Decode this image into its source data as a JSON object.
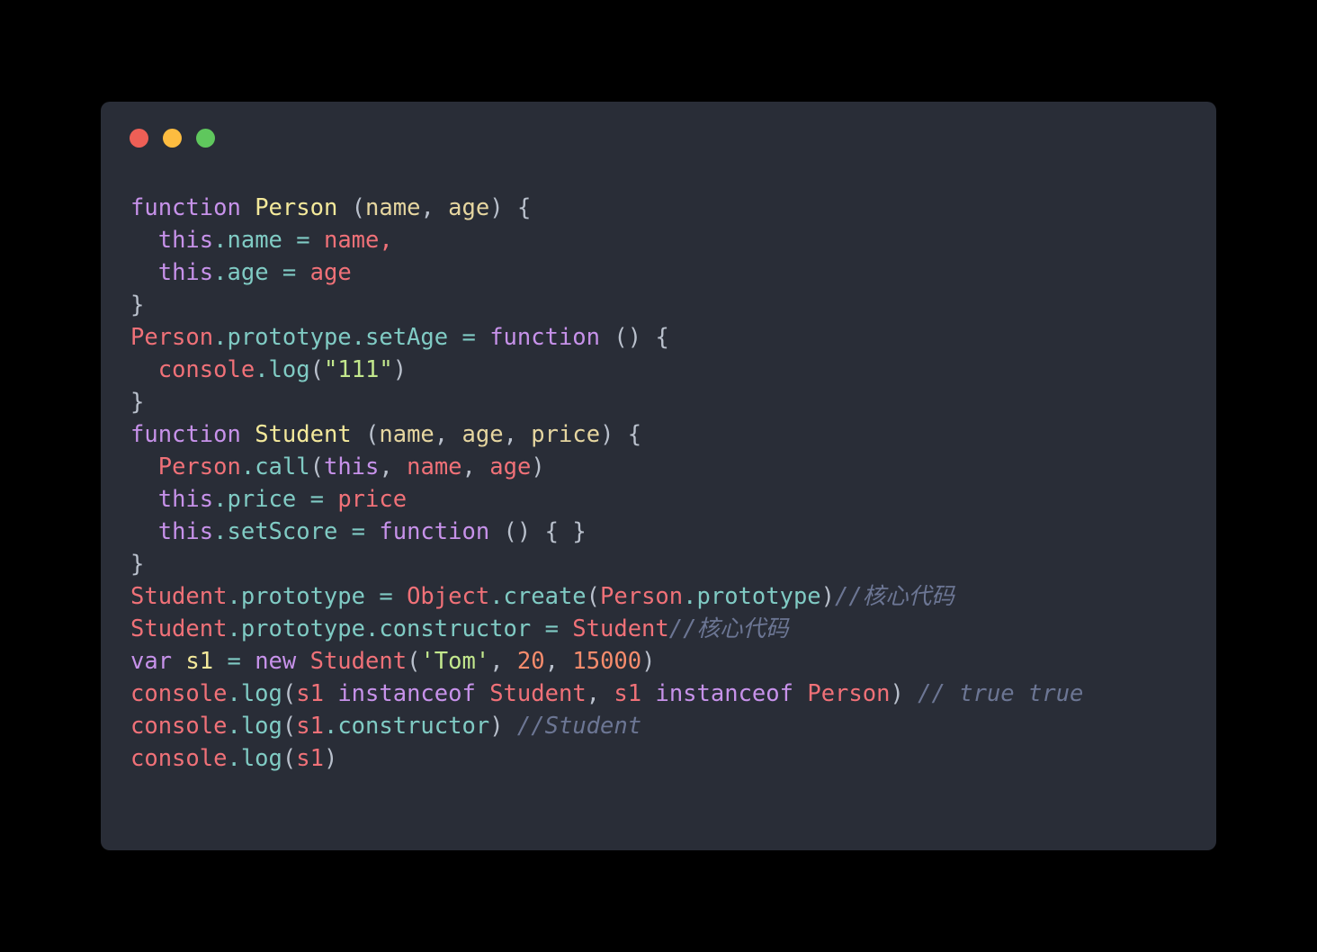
{
  "window": {
    "name": "code-snippet-card",
    "background_color": "#000000",
    "card_color": "#292d37",
    "controls": [
      {
        "name": "close",
        "label": "Close",
        "color": "#ee5f56"
      },
      {
        "name": "minimize",
        "label": "Minimize",
        "color": "#fdbc40"
      },
      {
        "name": "maximize",
        "label": "Maximize",
        "color": "#5fc75d"
      }
    ]
  },
  "theme": {
    "keyword": "#c792ea",
    "function_name": "#f4e99b",
    "parameter": "#e6d6a0",
    "identifier": "#f07178",
    "property": "#80cbc4",
    "punctuation": "#b9c0cc",
    "string": "#c3e88d",
    "number": "#f78c6c",
    "comment": "#6c7694"
  },
  "code": {
    "language": "javascript",
    "full_text": "function Person (name, age) {\n  this.name = name,\n  this.age = age\n}\nPerson.prototype.setAge = function () {\n  console.log(\"111\")\n}\nfunction Student (name, age, price) {\n  Person.call(this, name, age)\n  this.price = price\n  this.setScore = function () { }\n}\nStudent.prototype = Object.create(Person.prototype)//核心代码\nStudent.prototype.constructor = Student//核心代码\nvar s1 = new Student('Tom', 20, 15000)\nconsole.log(s1 instanceof Student, s1 instanceof Person) // true true\nconsole.log(s1.constructor) //Student\nconsole.log(s1)",
    "lines": [
      "function Person (name, age) {",
      "  this.name = name,",
      "  this.age = age",
      "}",
      "Person.prototype.setAge = function () {",
      "  console.log(\"111\")",
      "}",
      "function Student (name, age, price) {",
      "  Person.call(this, name, age)",
      "  this.price = price",
      "  this.setScore = function () { }",
      "}",
      "Student.prototype = Object.create(Person.prototype)//核心代码",
      "Student.prototype.constructor = Student//核心代码",
      "var s1 = new Student('Tom', 20, 15000)",
      "console.log(s1 instanceof Student, s1 instanceof Person) // true true",
      "console.log(s1.constructor) //Student",
      "console.log(s1)"
    ],
    "tokens": {
      "l1": {
        "kw_function": "function",
        "name": "Person",
        "open_paren": " (",
        "p1": "name",
        "comma1": ", ",
        "p2": "age",
        "close": ") ",
        "brace": "{"
      },
      "l2": {
        "kw_this": "this",
        "dot_name": ".name",
        "eq": " = ",
        "val": "name",
        "comma": ","
      },
      "l3": {
        "kw_this": "this",
        "dot_age": ".age",
        "eq": " = ",
        "val": "age"
      },
      "l4": {
        "brace": "}"
      },
      "l5": {
        "obj": "Person",
        "props": ".prototype.setAge",
        "eq": " = ",
        "kw_function": "function",
        "parens": " () ",
        "brace": "{"
      },
      "l6": {
        "obj": "console",
        "prop": ".log",
        "open": "(",
        "str": "\"111\"",
        "close": ")"
      },
      "l7": {
        "brace": "}"
      },
      "l8": {
        "kw_function": "function",
        "name": "Student",
        "open_paren": " (",
        "p1": "name",
        "c1": ", ",
        "p2": "age",
        "c2": ", ",
        "p3": "price",
        "close": ") ",
        "brace": "{"
      },
      "l9": {
        "obj": "Person",
        "prop": ".call",
        "open": "(",
        "kw_this": "this",
        "c1": ", ",
        "a1": "name",
        "c2": ", ",
        "a2": "age",
        "close": ")"
      },
      "l10": {
        "kw_this": "this",
        "prop": ".price",
        "eq": " = ",
        "val": "price"
      },
      "l11": {
        "kw_this": "this",
        "prop": ".setScore",
        "eq": " = ",
        "kw_function": "function",
        "parens": " () ",
        "brace": "{ }"
      },
      "l12": {
        "brace": "}"
      },
      "l13": {
        "obj": "Student",
        "prop": ".prototype",
        "eq": " = ",
        "obj2": "Object",
        "prop2": ".create",
        "open": "(",
        "obj3": "Person",
        "prop3": ".prototype",
        "close": ")",
        "comment": "//核心代码"
      },
      "l14": {
        "obj": "Student",
        "prop": ".prototype.constructor",
        "eq": " = ",
        "val": "Student",
        "comment": "//核心代码"
      },
      "l15": {
        "kw_var": "var",
        "varname": " s1",
        "eq": " = ",
        "kw_new": "new",
        "ctor": " Student",
        "open": "(",
        "str": "'Tom'",
        "c1": ", ",
        "n1": "20",
        "c2": ", ",
        "n2": "15000",
        "close": ")"
      },
      "l16": {
        "obj": "console",
        "prop": ".log",
        "open": "(",
        "a1": "s1",
        "kw_instanceof": " instanceof ",
        "t1": "Student",
        "c": ", ",
        "a2": "s1",
        "kw_instanceof2": " instanceof ",
        "t2": "Person",
        "close": ")",
        "comment": " // true true"
      },
      "l17": {
        "obj": "console",
        "prop": ".log",
        "open": "(",
        "a1": "s1",
        "prop2": ".constructor",
        "close": ")",
        "comment": " //Student"
      },
      "l18": {
        "obj": "console",
        "prop": ".log",
        "open": "(",
        "a1": "s1",
        "close": ")"
      }
    }
  }
}
